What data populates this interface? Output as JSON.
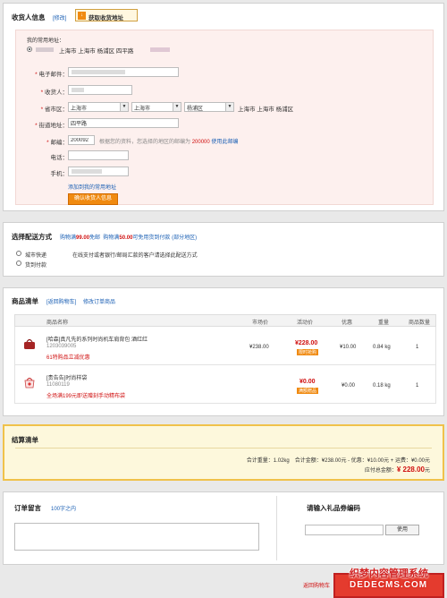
{
  "shipping_info": {
    "title": "收货人信息",
    "edit_link": "[修改]",
    "fetch_button": "获取收货地址",
    "common_address_label": "我的常用地址：",
    "common_address_value": "上海市 上海市 杨浦区 四平路",
    "fields": {
      "email_label": "电子邮件：",
      "name_label": "收货人：",
      "region_label": "省市区：",
      "region_province": "上海市",
      "region_city": "上海市",
      "region_district": "杨浦区",
      "region_text": "上海市 上海市 杨浦区",
      "address_label": "街道地址：",
      "address_value": "四平路",
      "zip_label": "邮编：",
      "zip_value": "200092",
      "zip_hint_a": "根据您的资料，您选择的地区的邮编为",
      "zip_hint_code": "200000",
      "zip_hint_link": "使用此邮编",
      "phone_label": "电话：",
      "mobile_label": "手机："
    },
    "add_to_common_link": "添加到我的常用地址",
    "confirm_button": "确认收货人信息"
  },
  "delivery": {
    "title": "选择配送方式",
    "promo_a": "购物满",
    "promo_a_amount": "99.00",
    "promo_a_tail": "免邮",
    "promo_b": "购物满",
    "promo_b_amount": "50.00",
    "promo_b_tail": "可免用货到付款",
    "promo_b_note": "(部分地区)",
    "options": [
      {
        "label": "城市快递",
        "note": "在线支付或者银行/邮局汇款的客户请选择此配送方式"
      },
      {
        "label": "货到付款",
        "note": ""
      }
    ]
  },
  "items": {
    "title": "商品清单",
    "back_link": "[返回购物车]",
    "edit_link": "修改订单商品",
    "headers": [
      "商品名称",
      "市场价",
      "活动价",
      "优惠",
      "重量",
      "商品数量"
    ],
    "rows": [
      {
        "name": "[哈森]真凡先的系列时尚机车肩背包 酒红红",
        "code": "1203039005",
        "promo": "61特购品立减优惠",
        "market_price": "¥238.00",
        "sale_price": "¥228.00",
        "badge": "限时抢购",
        "discount": "¥10.00",
        "weight": "0.84 kg",
        "qty": "1"
      },
      {
        "name": "[贵告告]时尚样袋",
        "code": "11080119",
        "promo": "全场满199元即送赠刻手动精布袋",
        "market_price": "",
        "sale_price": "¥0.00",
        "badge": "满额赠品",
        "discount": "¥0.00",
        "weight": "0.18 kg",
        "qty": "1"
      }
    ]
  },
  "settlement": {
    "title": "结算清单",
    "line1": "合计重量：1.02kg　合计金额：¥238.00元 - 优惠：¥10.00元 + 运费：¥0.00元",
    "total_label": "应付总金额：",
    "total_value": "¥ 228.00",
    "total_unit": "元"
  },
  "message": {
    "title": "订单留言",
    "limit": "100字之内"
  },
  "coupon": {
    "title": "请输入礼品劵编码",
    "use_button": "使用"
  },
  "footer": {
    "back_link": "返回购物车",
    "watermark_a": "织梦内容管理系统",
    "watermark_b": "DEDECMS.COM"
  },
  "colors": {
    "accent_orange": "#f08a10",
    "price_red": "#d01010",
    "link_blue": "#1a5fb4",
    "settle_bg": "#fdf8dc",
    "settle_border": "#f0c24a"
  }
}
